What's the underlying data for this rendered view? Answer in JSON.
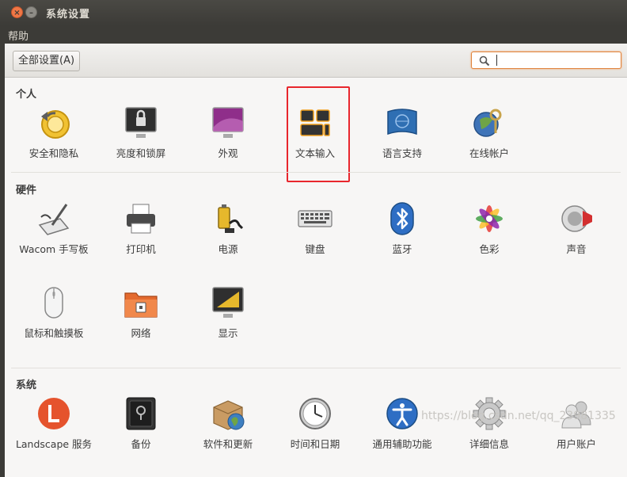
{
  "window": {
    "title": "系统设置",
    "close_glyph": "×",
    "min_glyph": "–"
  },
  "menu": {
    "help": "帮助"
  },
  "toolbar": {
    "all_settings": "全部设置(A)",
    "search_value": ""
  },
  "sections": [
    {
      "title": "个人",
      "items": [
        {
          "label": "安全和隐私",
          "icon": "security-privacy-icon"
        },
        {
          "label": "亮度和锁屏",
          "icon": "brightness-lock-icon"
        },
        {
          "label": "外观",
          "icon": "appearance-icon"
        },
        {
          "label": "文本输入",
          "icon": "text-entry-icon"
        },
        {
          "label": "语言支持",
          "icon": "language-support-icon"
        },
        {
          "label": "在线帐户",
          "icon": "online-accounts-icon"
        }
      ]
    },
    {
      "title": "硬件",
      "items": [
        {
          "label": "Wacom 手写板",
          "icon": "wacom-tablet-icon"
        },
        {
          "label": "打印机",
          "icon": "printer-icon"
        },
        {
          "label": "电源",
          "icon": "power-icon"
        },
        {
          "label": "键盘",
          "icon": "keyboard-icon"
        },
        {
          "label": "蓝牙",
          "icon": "bluetooth-icon"
        },
        {
          "label": "色彩",
          "icon": "color-icon"
        },
        {
          "label": "声音",
          "icon": "sound-icon"
        },
        {
          "label": "鼠标和触摸板",
          "icon": "mouse-touchpad-icon"
        },
        {
          "label": "网络",
          "icon": "network-icon"
        },
        {
          "label": "显示",
          "icon": "display-icon"
        }
      ]
    },
    {
      "title": "系统",
      "items": [
        {
          "label": "Landscape 服务",
          "icon": "landscape-icon"
        },
        {
          "label": "备份",
          "icon": "backup-icon"
        },
        {
          "label": "软件和更新",
          "icon": "software-updates-icon"
        },
        {
          "label": "时间和日期",
          "icon": "time-date-icon"
        },
        {
          "label": "通用辅助功能",
          "icon": "universal-access-icon"
        },
        {
          "label": "详细信息",
          "icon": "details-icon"
        },
        {
          "label": "用户账户",
          "icon": "user-accounts-icon"
        }
      ]
    }
  ],
  "watermark": "https://blog.csdn.net/qq_23981335",
  "colors": {
    "accent": "#e0833c",
    "highlight": "#e8262c",
    "titlebar": "#3c3b37"
  }
}
